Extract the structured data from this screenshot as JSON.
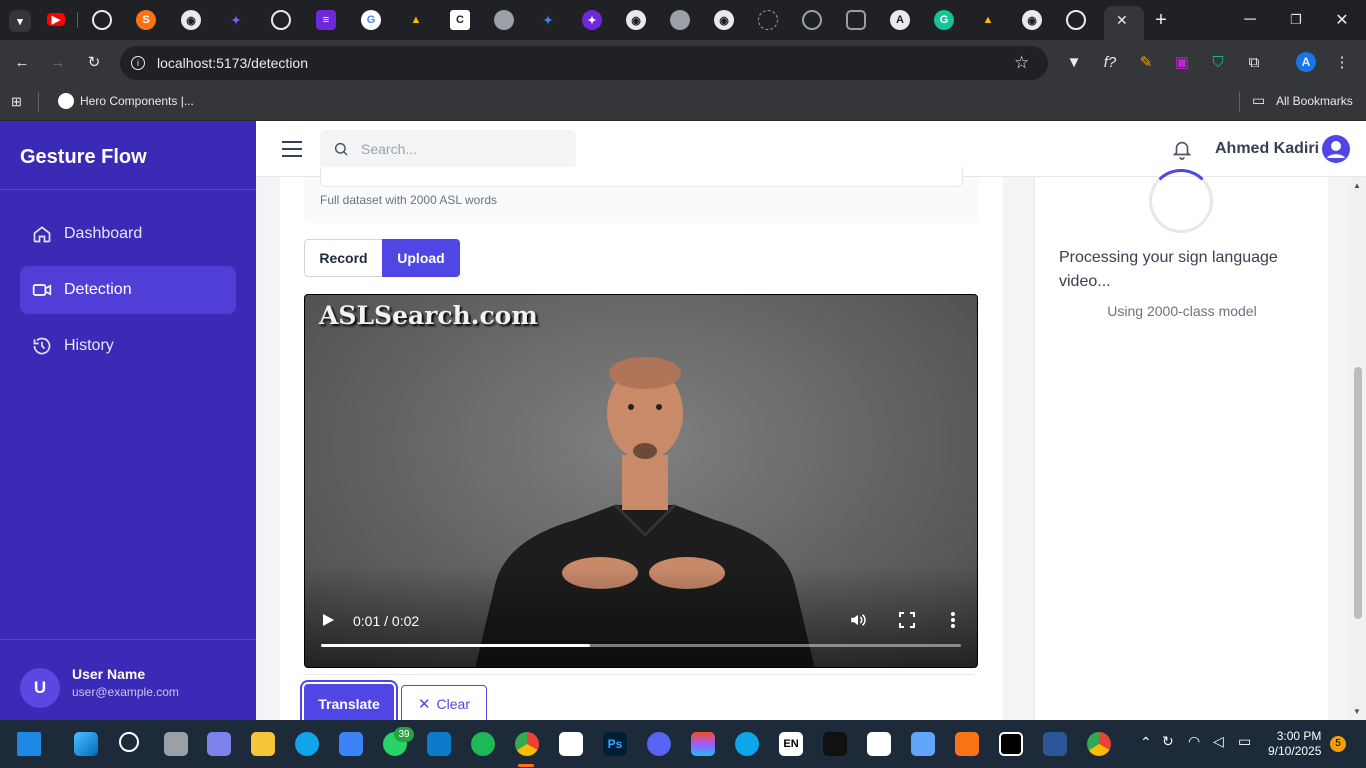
{
  "browser": {
    "url": "localhost:5173/detection",
    "bookmark_item": "Hero Components |...",
    "all_bookmarks": "All Bookmarks",
    "profile_letter": "A"
  },
  "sidebar": {
    "brand": "Gesture Flow",
    "items": [
      {
        "label": "Dashboard",
        "icon": "home-icon",
        "active": false
      },
      {
        "label": "Detection",
        "icon": "video-camera-icon",
        "active": true
      },
      {
        "label": "History",
        "icon": "history-icon",
        "active": false
      }
    ],
    "user": {
      "initial": "U",
      "name": "User Name",
      "email": "user@example.com"
    }
  },
  "header": {
    "search_placeholder": "Search...",
    "user_name": "Ahmed Kadiri"
  },
  "main": {
    "dataset_hint": "Full dataset with 2000 ASL words",
    "tabs": {
      "record": "Record",
      "upload": "Upload",
      "active": "Upload"
    },
    "video": {
      "watermark": "ASLSearch.com",
      "time": "0:01 / 0:02",
      "progress": 0.42
    },
    "translate_label": "Translate",
    "clear_label": "Clear"
  },
  "status": {
    "processing": "Processing your sign language video...",
    "model": "Using 2000-class model"
  },
  "taskbar": {
    "time": "3:00 PM",
    "date": "9/10/2025",
    "whatsapp_badge": "39",
    "notif_badge": "5",
    "lang": "EN"
  },
  "colors": {
    "sidebar": "#3b2ab5",
    "accent": "#4f46e5"
  }
}
